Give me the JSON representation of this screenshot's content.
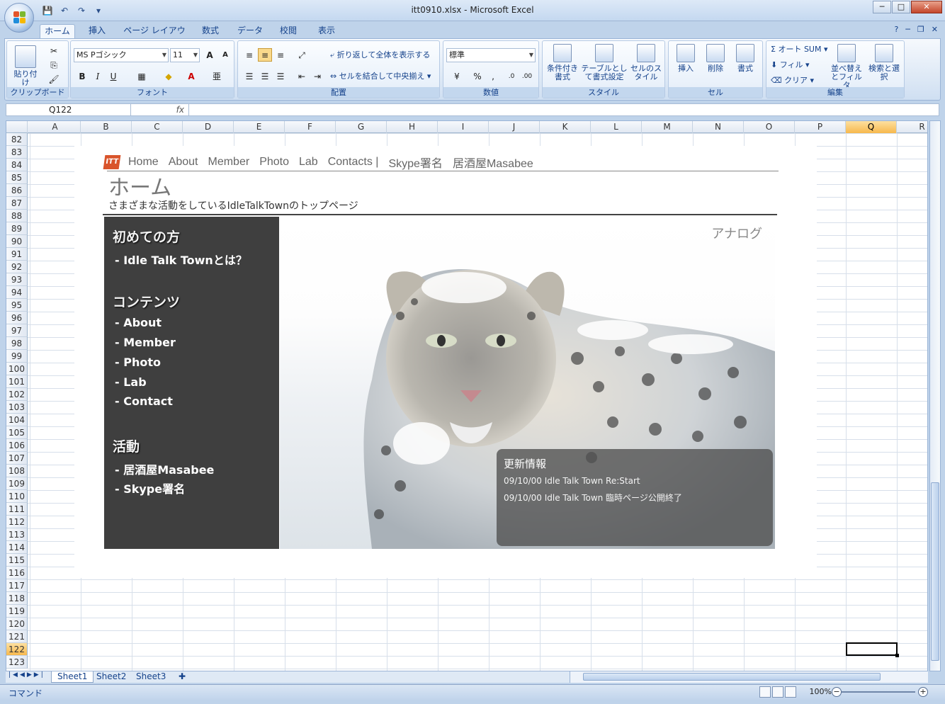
{
  "window": {
    "title": "itt0910.xlsx - Microsoft Excel",
    "controls": {
      "minimize": "─",
      "maximize": "□",
      "close": "✕"
    }
  },
  "ribbon": {
    "tabs": [
      "ホーム",
      "挿入",
      "ページ レイアウト",
      "数式",
      "データ",
      "校閲",
      "表示"
    ],
    "active_tab": "ホーム",
    "clipboard": {
      "paste": "貼り付け",
      "label": "クリップボード"
    },
    "font": {
      "name": "MS Pゴシック",
      "size": "11",
      "label": "フォント"
    },
    "alignment": {
      "wrap": "折り返して全体を表示する",
      "merge": "セルを結合して中央揃え",
      "label": "配置"
    },
    "number": {
      "format": "標準",
      "label": "数値"
    },
    "styles": {
      "conditional": "条件付き書式",
      "table": "テーブルとして書式設定",
      "cell": "セルのスタイル",
      "label": "スタイル"
    },
    "cells": {
      "insert": "挿入",
      "delete": "削除",
      "format": "書式",
      "label": "セル"
    },
    "editing": {
      "autosum": "オート SUM",
      "fill": "フィル",
      "clear": "クリア",
      "sort": "並べ替えとフィルタ",
      "find": "検索と選択",
      "label": "編集"
    }
  },
  "formula_bar": {
    "name_box": "Q122",
    "fx": "fx",
    "value": ""
  },
  "columns": [
    "A",
    "B",
    "C",
    "D",
    "E",
    "F",
    "G",
    "H",
    "I",
    "J",
    "K",
    "L",
    "M",
    "N",
    "O",
    "P",
    "Q",
    "R"
  ],
  "selected_column": "Q",
  "rows": [
    "82",
    "83",
    "84",
    "85",
    "86",
    "87",
    "88",
    "89",
    "90",
    "91",
    "92",
    "93",
    "94",
    "95",
    "96",
    "97",
    "98",
    "99",
    "100",
    "101",
    "102",
    "103",
    "104",
    "105",
    "106",
    "107",
    "108",
    "109",
    "110",
    "111",
    "112",
    "113",
    "114",
    "115",
    "116",
    "117",
    "118",
    "119",
    "120",
    "121",
    "122",
    "123"
  ],
  "selected_row": "122",
  "webpage": {
    "logo": "ITT",
    "nav": [
      "Home",
      "About",
      "Member",
      "Photo",
      "Lab",
      "Contacts |",
      "Skype署名",
      "居酒屋Masabee"
    ],
    "title": "ホーム",
    "subtitle": "さまざまな活動をしているIdleTalkTownのトップページ",
    "sidebar": {
      "sections": [
        {
          "heading": "初めての方",
          "items": [
            "- Idle Talk Townとは？"
          ]
        },
        {
          "heading": "コンテンツ",
          "items": [
            "- About",
            "- Member",
            "- Photo",
            "- Lab",
            "- Contact"
          ]
        },
        {
          "heading": "活動",
          "items": [
            "- 居酒屋Masabee",
            "- Skype署名"
          ]
        }
      ]
    },
    "hero_caption": "アナログ",
    "news": {
      "title": "更新情報",
      "items": [
        "09/10/00 Idle Talk Town Re:Start",
        "09/10/00 Idle Talk Town 臨時ページ公開終了"
      ]
    }
  },
  "sheet_tabs": [
    "Sheet1",
    "Sheet2",
    "Sheet3"
  ],
  "active_sheet": "Sheet1",
  "status": {
    "mode": "コマンド",
    "zoom": "100%"
  },
  "colors": {
    "sidebar": "#3f3f3f",
    "accent": "#f7b84d",
    "logo": "#d9542b"
  }
}
